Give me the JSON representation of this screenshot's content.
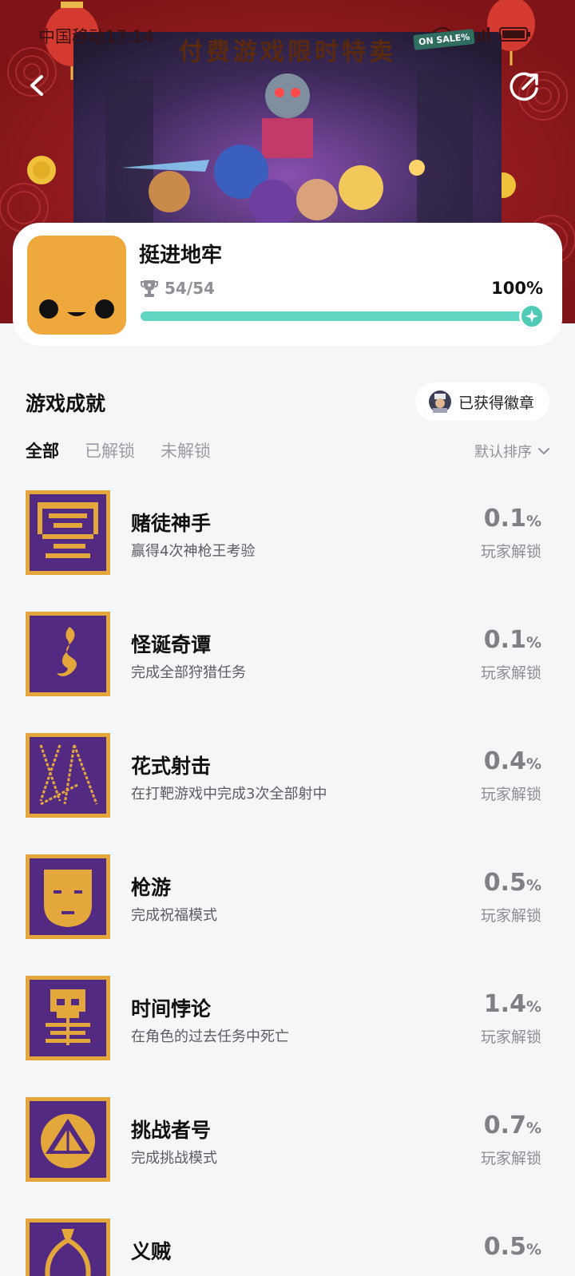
{
  "status_bar": {
    "text": "中国移动17:14"
  },
  "banner": {
    "sale_title": "付费游戏限时特卖",
    "sale_tag": "ON SALE%"
  },
  "game": {
    "title": "挺进地牢",
    "trophy_count": "54/54",
    "progress_percent": "100%",
    "progress_value": 100
  },
  "section": {
    "title": "游戏成就",
    "badge_button": "已获得徽章"
  },
  "tabs": [
    {
      "label": "全部",
      "active": true
    },
    {
      "label": "已解锁",
      "active": false
    },
    {
      "label": "未解锁",
      "active": false
    }
  ],
  "sort": {
    "label": "默认排序"
  },
  "achievements": [
    {
      "name": "赌徒神手",
      "desc": "赢得4次神枪王考验",
      "pct": "0.1",
      "unit": "%",
      "pct_label": "玩家解锁",
      "icon": "castle-icon"
    },
    {
      "name": "怪诞奇谭",
      "desc": "完成全部狩猎任务",
      "pct": "0.1",
      "unit": "%",
      "pct_label": "玩家解锁",
      "icon": "flame-icon"
    },
    {
      "name": "花式射击",
      "desc": "在打靶游戏中完成3次全部射中",
      "pct": "0.4",
      "unit": "%",
      "pct_label": "玩家解锁",
      "icon": "target-lines-icon"
    },
    {
      "name": "枪游",
      "desc": "完成祝福模式",
      "pct": "0.5",
      "unit": "%",
      "pct_label": "玩家解锁",
      "icon": "mask-icon"
    },
    {
      "name": "时间悖论",
      "desc": "在角色的过去任务中死亡",
      "pct": "1.4",
      "unit": "%",
      "pct_label": "玩家解锁",
      "icon": "skull-icon"
    },
    {
      "name": "挑战者号",
      "desc": "完成挑战模式",
      "pct": "0.7",
      "unit": "%",
      "pct_label": "玩家解锁",
      "icon": "d20-icon"
    },
    {
      "name": "义贼",
      "desc": "",
      "pct": "0.5",
      "unit": "%",
      "pct_label": "",
      "icon": "money-bag-icon"
    }
  ]
}
